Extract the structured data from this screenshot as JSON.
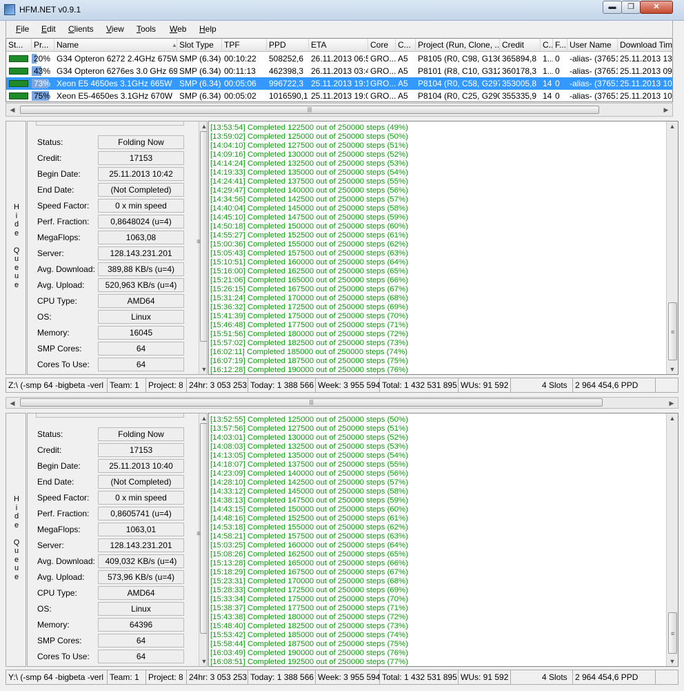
{
  "window": {
    "title": "HFM.NET v0.9.1",
    "min_label": "▬",
    "max_label": "❐",
    "close_label": "✕"
  },
  "menu": [
    {
      "pre": "",
      "ul": "F",
      "post": "ile"
    },
    {
      "pre": "",
      "ul": "E",
      "post": "dit"
    },
    {
      "pre": "",
      "ul": "C",
      "post": "lients"
    },
    {
      "pre": "",
      "ul": "V",
      "post": "iew"
    },
    {
      "pre": "",
      "ul": "T",
      "post": "ools"
    },
    {
      "pre": "",
      "ul": "W",
      "post": "eb"
    },
    {
      "pre": "",
      "ul": "H",
      "post": "elp"
    }
  ],
  "grid": {
    "headers": [
      "St...",
      "Pr...",
      "Name",
      "Slot Type",
      "TPF",
      "PPD",
      "ETA",
      "Core",
      "C...",
      "Project (Run, Clone, ...",
      "Credit",
      "C...",
      "F...",
      "User Name",
      "Download Time"
    ],
    "sort_arrow": "▲",
    "rows": [
      {
        "progress": "20%",
        "progress_frac": 0.2,
        "name": "G34 Opteron 6272 2.4GHz 675Watt",
        "slot_type": "SMP (6.34)",
        "tpf": "00:10:22",
        "ppd": "508252,6",
        "eta": "26.11.2013 06:50",
        "core": "GRO...",
        "c": "A5",
        "project": "P8105 (R0, C98, G136)",
        "credit": "365894,8",
        "c2": "1...",
        "f": "0",
        "user": "-alias- (37651)",
        "download": "25.11.2013 13:28",
        "selected": false
      },
      {
        "progress": "43%",
        "progress_frac": 0.43,
        "name": "G34 Opteron 6276es 3.0 GHz 695...",
        "slot_type": "SMP (6.34)",
        "tpf": "00:11:13",
        "ppd": "462398,3",
        "eta": "26.11.2013 03:40",
        "core": "GRO...",
        "c": "A5",
        "project": "P8101 (R8, C10, G312)",
        "credit": "360178,3",
        "c2": "1...",
        "f": "0",
        "user": "-alias- (37651)",
        "download": "25.11.2013 09:00",
        "selected": false
      },
      {
        "progress": "73%",
        "progress_frac": 0.73,
        "name": "Xeon E5 4650es 3.1GHz 665W",
        "slot_type": "SMP (6.34)",
        "tpf": "00:05:06",
        "ppd": "996722,3",
        "eta": "25.11.2013 19:19",
        "core": "GRO...",
        "c": "A5",
        "project": "P8104 (R0, C58, G297)",
        "credit": "353005,8",
        "c2": "14",
        "f": "0",
        "user": "-alias- (37651)",
        "download": "25.11.2013 10:42",
        "selected": true
      },
      {
        "progress": "75%",
        "progress_frac": 0.75,
        "name": "Xeon E5-4650es 3.1GHz 670W",
        "slot_type": "SMP (6.34)",
        "tpf": "00:05:02",
        "ppd": "1016590,1",
        "eta": "25.11.2013 19:07",
        "core": "GRO...",
        "c": "A5",
        "project": "P8104 (R0, C25, G290)",
        "credit": "355335,9",
        "c2": "14",
        "f": "0",
        "user": "-alias- (37651)",
        "download": "25.11.2013 10:40",
        "selected": false
      }
    ]
  },
  "hide_queue_letters": [
    "H",
    "i",
    "d",
    "e",
    "",
    "Q",
    "u",
    "e",
    "u",
    "e"
  ],
  "field_labels": [
    "Status:",
    "Credit:",
    "Begin Date:",
    "End Date:",
    "Speed Factor:",
    "Perf. Fraction:",
    "MegaFlops:",
    "Server:",
    "Avg. Download:",
    "Avg. Upload:",
    "CPU Type:",
    "OS:",
    "Memory:",
    "SMP Cores:",
    "Cores To Use:"
  ],
  "panes": [
    {
      "values": [
        "Folding Now",
        "17153",
        "25.11.2013 10:42",
        "(Not Completed)",
        "0 x min speed",
        "0,8648024 (u=4)",
        "1063,08",
        "128.143.231.201",
        "389,88 KB/s (u=4)",
        "520,963 KB/s (u=4)",
        "AMD64",
        "Linux",
        "16045",
        "64",
        "64"
      ],
      "log": [
        "[13:53:54] Completed 122500 out of 250000 steps  (49%)",
        "[13:59:02] Completed 125000 out of 250000 steps  (50%)",
        "[14:04:10] Completed 127500 out of 250000 steps  (51%)",
        "[14:09:16] Completed 130000 out of 250000 steps  (52%)",
        "[14:14:24] Completed 132500 out of 250000 steps  (53%)",
        "[14:19:33] Completed 135000 out of 250000 steps  (54%)",
        "[14:24:41] Completed 137500 out of 250000 steps  (55%)",
        "[14:29:47] Completed 140000 out of 250000 steps  (56%)",
        "[14:34:56] Completed 142500 out of 250000 steps  (57%)",
        "[14:40:04] Completed 145000 out of 250000 steps  (58%)",
        "[14:45:10] Completed 147500 out of 250000 steps  (59%)",
        "[14:50:18] Completed 150000 out of 250000 steps  (60%)",
        "[14:55:27] Completed 152500 out of 250000 steps  (61%)",
        "[15:00:36] Completed 155000 out of 250000 steps  (62%)",
        "[15:05:43] Completed 157500 out of 250000 steps  (63%)",
        "[15:10:51] Completed 160000 out of 250000 steps  (64%)",
        "[15:16:00] Completed 162500 out of 250000 steps  (65%)",
        "[15:21:06] Completed 165000 out of 250000 steps  (66%)",
        "[15:26:15] Completed 167500 out of 250000 steps  (67%)",
        "[15:31:24] Completed 170000 out of 250000 steps  (68%)",
        "[15:36:32] Completed 172500 out of 250000 steps  (69%)",
        "[15:41:39] Completed 175000 out of 250000 steps  (70%)",
        "[15:46:48] Completed 177500 out of 250000 steps  (71%)",
        "[15:51:56] Completed 180000 out of 250000 steps  (72%)",
        "[15:57:02] Completed 182500 out of 250000 steps  (73%)",
        "[16:02:11] Completed 185000 out of 250000 steps  (74%)",
        "[16:07:19] Completed 187500 out of 250000 steps  (75%)",
        "[16:12:28] Completed 190000 out of 250000 steps  (76%)"
      ],
      "status": {
        "path": "Z:\\ (-smp 64 -bigbeta -verl",
        "team": "Team: 1",
        "project": "Project: 8",
        "h24": "24hr: 3 053 253",
        "today": "Today: 1 388 566",
        "week": "Week: 3 955 594",
        "total": "Total: 1 432 531 895",
        "wus": "WUs: 91 592",
        "slots": "4 Slots",
        "ppd": "2 964 454,6 PPD"
      }
    },
    {
      "values": [
        "Folding Now",
        "17153",
        "25.11.2013 10:40",
        "(Not Completed)",
        "0 x min speed",
        "0,8605741 (u=4)",
        "1063,01",
        "128.143.231.201",
        "409,032 KB/s (u=4)",
        "573,96 KB/s (u=4)",
        "AMD64",
        "Linux",
        "64396",
        "64",
        "64"
      ],
      "log": [
        "[13:52:55] Completed 125000 out of 250000 steps  (50%)",
        "[13:57:56] Completed 127500 out of 250000 steps  (51%)",
        "[14:03:01] Completed 130000 out of 250000 steps  (52%)",
        "[14:08:03] Completed 132500 out of 250000 steps  (53%)",
        "[14:13:05] Completed 135000 out of 250000 steps  (54%)",
        "[14:18:07] Completed 137500 out of 250000 steps  (55%)",
        "[14:23:09] Completed 140000 out of 250000 steps  (56%)",
        "[14:28:10] Completed 142500 out of 250000 steps  (57%)",
        "[14:33:12] Completed 145000 out of 250000 steps  (58%)",
        "[14:38:13] Completed 147500 out of 250000 steps  (59%)",
        "[14:43:15] Completed 150000 out of 250000 steps  (60%)",
        "[14:48:16] Completed 152500 out of 250000 steps  (61%)",
        "[14:53:18] Completed 155000 out of 250000 steps  (62%)",
        "[14:58:21] Completed 157500 out of 250000 steps  (63%)",
        "[15:03:25] Completed 160000 out of 250000 steps  (64%)",
        "[15:08:26] Completed 162500 out of 250000 steps  (65%)",
        "[15:13:28] Completed 165000 out of 250000 steps  (66%)",
        "[15:18:29] Completed 167500 out of 250000 steps  (67%)",
        "[15:23:31] Completed 170000 out of 250000 steps  (68%)",
        "[15:28:33] Completed 172500 out of 250000 steps  (69%)",
        "[15:33:34] Completed 175000 out of 250000 steps  (70%)",
        "[15:38:37] Completed 177500 out of 250000 steps  (71%)",
        "[15:43:38] Completed 180000 out of 250000 steps  (72%)",
        "[15:48:40] Completed 182500 out of 250000 steps  (73%)",
        "[15:53:42] Completed 185000 out of 250000 steps  (74%)",
        "[15:58:44] Completed 187500 out of 250000 steps  (75%)",
        "[16:03:49] Completed 190000 out of 250000 steps  (76%)",
        "[16:08:51] Completed 192500 out of 250000 steps  (77%)"
      ],
      "status": {
        "path": "Y:\\ (-smp 64 -bigbeta -verl",
        "team": "Team: 1",
        "project": "Project: 8",
        "h24": "24hr: 3 053 253",
        "today": "Today: 1 388 566",
        "week": "Week: 3 955 594",
        "total": "Total: 1 432 531 895",
        "wus": "WUs: 91 592",
        "slots": "4 Slots",
        "ppd": "2 964 454,6 PPD"
      }
    }
  ],
  "scroll": {
    "left_arrow": "◀",
    "right_arrow": "▶",
    "up_arrow": "▲",
    "down_arrow": "▼",
    "grip": "|||",
    "vgrip": "≡"
  },
  "colors": {
    "log_text": "#0c9e0c",
    "selection": "#3399ff",
    "status_ok": "#1f8a2a"
  }
}
